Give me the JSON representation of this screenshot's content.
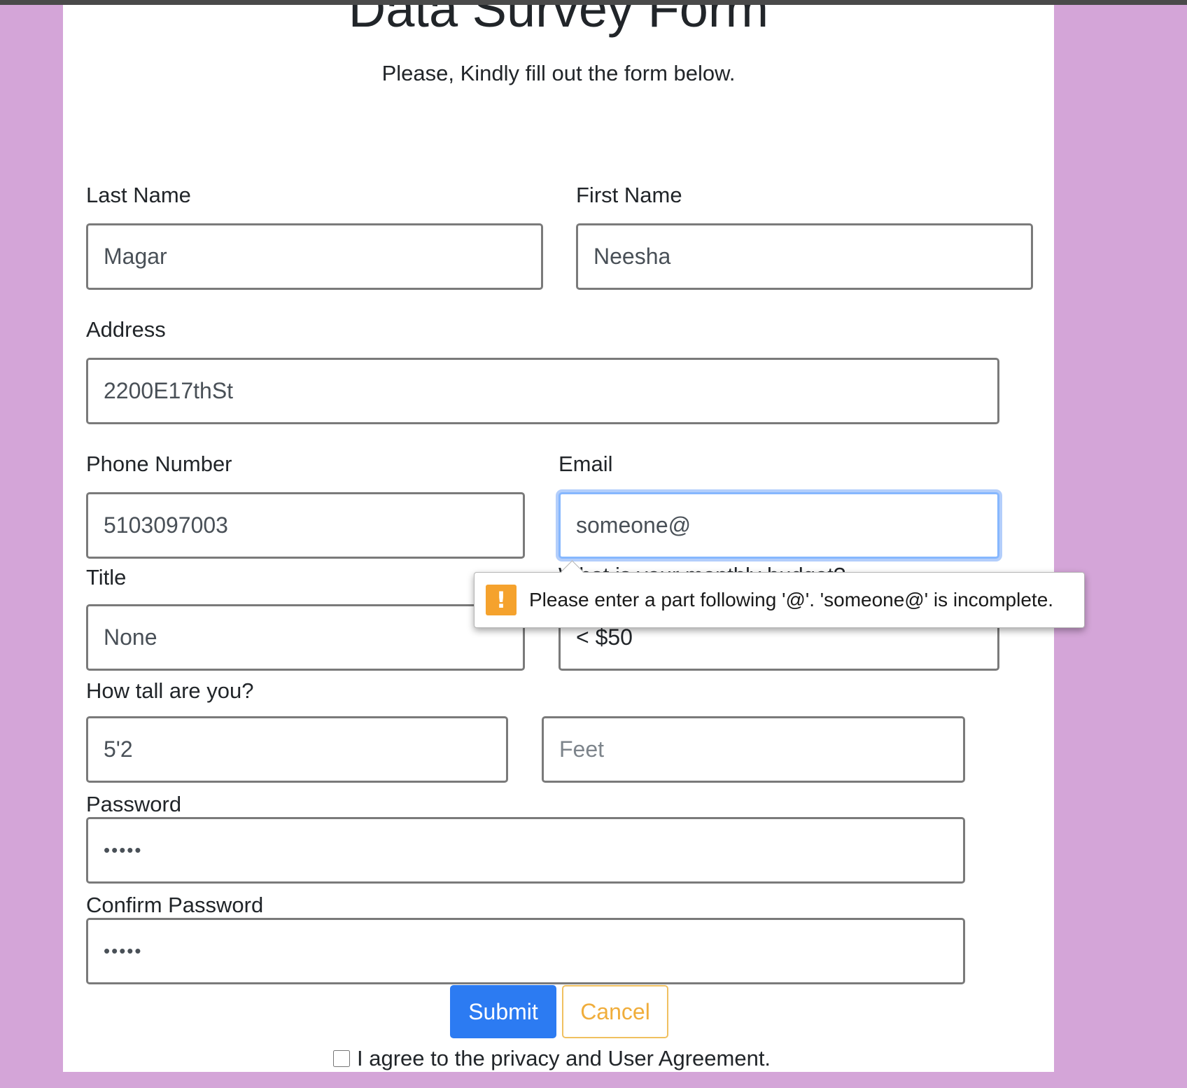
{
  "form": {
    "title": "Data Survey Form",
    "subtitle": "Please, Kindly fill out the form below.",
    "last_name": {
      "label": "Last Name",
      "value": "Magar"
    },
    "first_name": {
      "label": "First Name",
      "value": "Neesha"
    },
    "address": {
      "label": "Address",
      "value": "2200E17thSt"
    },
    "phone": {
      "label": "Phone Number",
      "value": "5103097003"
    },
    "email": {
      "label": "Email",
      "value": "someone@"
    },
    "title_field": {
      "label": "Title",
      "value": "None"
    },
    "budget": {
      "label": "What is your monthly budget?",
      "value": "< $50"
    },
    "height": {
      "label": "How tall are you?",
      "value": "5'2",
      "unit_placeholder": "Feet"
    },
    "password": {
      "label": "Password",
      "value": "•••••"
    },
    "confirm_password": {
      "label": "Confirm Password",
      "value": "•••••"
    },
    "submit_label": "Submit",
    "cancel_label": "Cancel",
    "agreement_label": "I agree to the privacy and User Agreement."
  },
  "validation": {
    "message": "Please enter a part following '@'. 'someone@' is incomplete.",
    "icon": "warning-icon"
  },
  "colors": {
    "page_background": "#d4a5d8",
    "submit_button": "#2c7bf2",
    "cancel_text": "#f0ad3b",
    "warning": "#f5a22d"
  }
}
